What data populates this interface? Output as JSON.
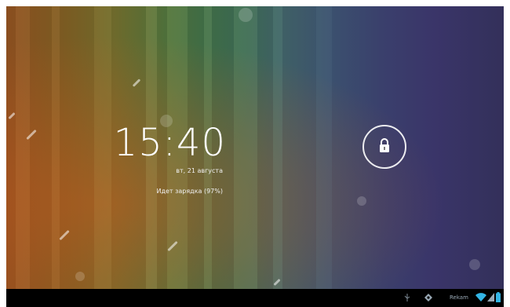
{
  "lockscreen": {
    "time": "15:40",
    "date": "вт, 21 августа",
    "charging_status": "Идет зарядка (97%)"
  },
  "status_bar": {
    "carrier": "Rekam",
    "icons": [
      "usb-icon",
      "debug-icon",
      "wifi-icon",
      "signal-icon",
      "battery-icon"
    ]
  },
  "icons": {
    "unlock": "lock-icon"
  },
  "colors": {
    "text": "#ffffff",
    "navbar": "#000000",
    "status_accent": "#33b5e5"
  }
}
